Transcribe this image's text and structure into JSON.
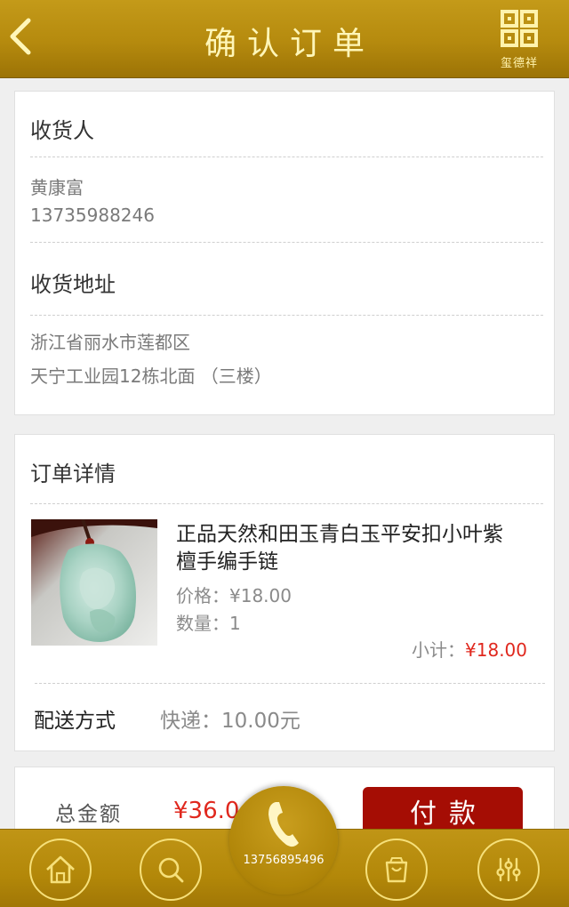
{
  "header": {
    "title": "确认订单",
    "logo_text": "玺德祥"
  },
  "receiver": {
    "title": "收货人",
    "name": "黄康富",
    "phone": "13735988246"
  },
  "address": {
    "title": "收货地址",
    "region": "浙江省丽水市莲都区",
    "detail": "天宁工业园12栋北面 （三楼）"
  },
  "order": {
    "title": "订单详情",
    "product_name": "正品天然和田玉青白玉平安扣小叶紫檀手编手链",
    "price": "价格：¥18.00",
    "quantity": "数量：1",
    "subtotal_label": "小计：",
    "subtotal_value": "¥18.00",
    "shipping_label": "配送方式",
    "shipping_value": "快递：10.00元"
  },
  "total": {
    "label": "总金额",
    "value": "¥36.0",
    "pay_label": "付款"
  },
  "footer": {
    "phone_number": "13756895496",
    "items": [
      "home-icon",
      "search-icon",
      "bag-icon",
      "settings-sliders-icon"
    ]
  },
  "colors": {
    "gold": "#b58a0e",
    "price_red": "#e0281e",
    "pay_button": "#a50d04"
  }
}
